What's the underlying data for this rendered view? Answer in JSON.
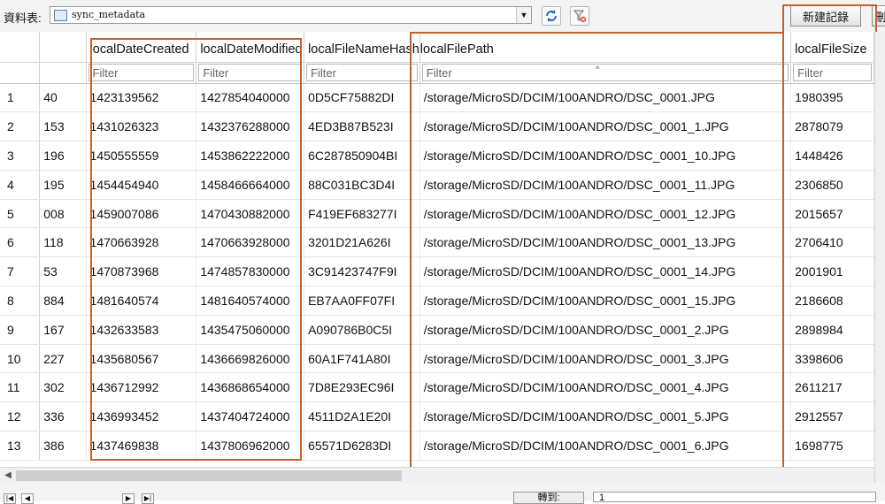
{
  "toolbar": {
    "table_label": "資料表:",
    "table_value": "sync_metadata",
    "new_record_label": "新建記錄",
    "delete_record_label": "刪"
  },
  "columns": [
    {
      "key": "a",
      "label": "",
      "filter_placeholder": ""
    },
    {
      "key": "created",
      "label": "localDateCreated",
      "filter_placeholder": "Filter"
    },
    {
      "key": "modified",
      "label": "localDateModified",
      "filter_placeholder": "Filter"
    },
    {
      "key": "hash",
      "label": "localFileNameHash",
      "filter_placeholder": "Filter"
    },
    {
      "key": "path",
      "label": "localFilePath",
      "filter_placeholder": "Filter"
    },
    {
      "key": "size",
      "label": "localFileSize",
      "filter_placeholder": "Filter"
    }
  ],
  "rows": [
    {
      "n": "1",
      "a": "40",
      "created": "1423139562",
      "modified": "1427854040000",
      "hash": "0D5CF75882DI",
      "path": "/storage/MicroSD/DCIM/100ANDRO/DSC_0001.JPG",
      "size": "1980395"
    },
    {
      "n": "2",
      "a": "153",
      "created": "1431026323",
      "modified": "1432376288000",
      "hash": "4ED3B87B523I",
      "path": "/storage/MicroSD/DCIM/100ANDRO/DSC_0001_1.JPG",
      "size": "2878079"
    },
    {
      "n": "3",
      "a": "196",
      "created": "1450555559",
      "modified": "1453862222000",
      "hash": "6C287850904BI",
      "path": "/storage/MicroSD/DCIM/100ANDRO/DSC_0001_10.JPG",
      "size": "1448426"
    },
    {
      "n": "4",
      "a": "195",
      "created": "1454454940",
      "modified": "1458466664000",
      "hash": "88C031BC3D4I",
      "path": "/storage/MicroSD/DCIM/100ANDRO/DSC_0001_11.JPG",
      "size": "2306850"
    },
    {
      "n": "5",
      "a": "008",
      "created": "1459007086",
      "modified": "1470430882000",
      "hash": "F419EF683277I",
      "path": "/storage/MicroSD/DCIM/100ANDRO/DSC_0001_12.JPG",
      "size": "2015657"
    },
    {
      "n": "6",
      "a": "118",
      "created": "1470663928",
      "modified": "1470663928000",
      "hash": "3201D21A626I",
      "path": "/storage/MicroSD/DCIM/100ANDRO/DSC_0001_13.JPG",
      "size": "2706410"
    },
    {
      "n": "7",
      "a": "53",
      "created": "1470873968",
      "modified": "1474857830000",
      "hash": "3C91423747F9I",
      "path": "/storage/MicroSD/DCIM/100ANDRO/DSC_0001_14.JPG",
      "size": "2001901"
    },
    {
      "n": "8",
      "a": "884",
      "created": "1481640574",
      "modified": "1481640574000",
      "hash": "EB7AA0FF07FI",
      "path": "/storage/MicroSD/DCIM/100ANDRO/DSC_0001_15.JPG",
      "size": "2186608"
    },
    {
      "n": "9",
      "a": "167",
      "created": "1432633583",
      "modified": "1435475060000",
      "hash": "A090786B0C5I",
      "path": "/storage/MicroSD/DCIM/100ANDRO/DSC_0001_2.JPG",
      "size": "2898984"
    },
    {
      "n": "10",
      "a": "227",
      "created": "1435680567",
      "modified": "1436669826000",
      "hash": "60A1F741A80I",
      "path": "/storage/MicroSD/DCIM/100ANDRO/DSC_0001_3.JPG",
      "size": "3398606"
    },
    {
      "n": "11",
      "a": "302",
      "created": "1436712992",
      "modified": "1436868654000",
      "hash": "7D8E293EC96I",
      "path": "/storage/MicroSD/DCIM/100ANDRO/DSC_0001_4.JPG",
      "size": "2611217"
    },
    {
      "n": "12",
      "a": "336",
      "created": "1436993452",
      "modified": "1437404724000",
      "hash": "4511D2A1E20I",
      "path": "/storage/MicroSD/DCIM/100ANDRO/DSC_0001_5.JPG",
      "size": "2912557"
    },
    {
      "n": "13",
      "a": "386",
      "created": "1437469838",
      "modified": "1437806962000",
      "hash": "65571D6283DI",
      "path": "/storage/MicroSD/DCIM/100ANDRO/DSC_0001_6.JPG",
      "size": "1698775"
    }
  ],
  "status": {
    "goto_label": "轉到:",
    "goto_value": "1"
  },
  "colors": {
    "highlight": "#c0622d"
  }
}
